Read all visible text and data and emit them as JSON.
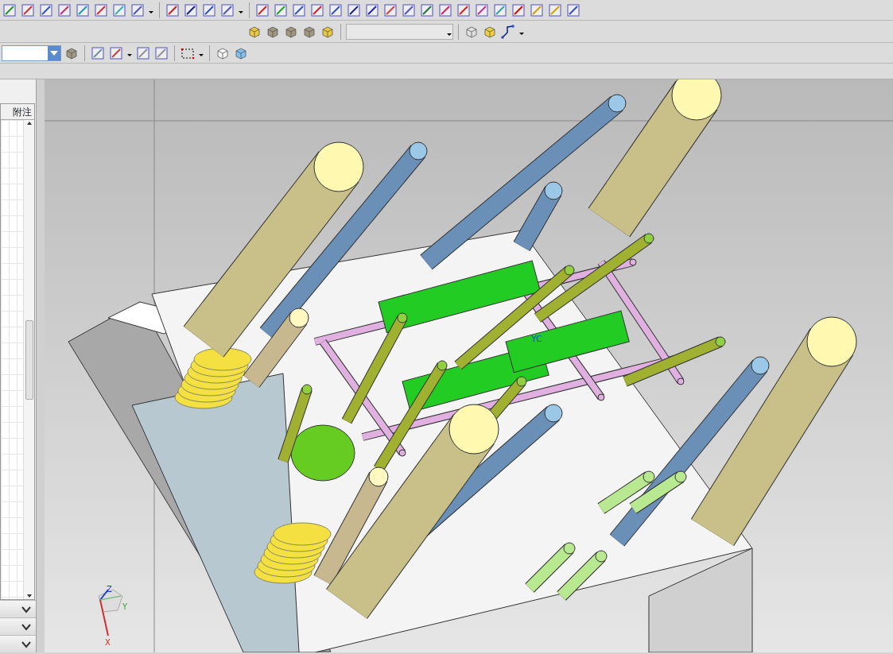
{
  "table": {
    "columns": [
      "附注"
    ]
  },
  "viewport": {
    "model_label": "YC",
    "triad_axes": [
      "Z",
      "Y",
      "X"
    ]
  }
}
